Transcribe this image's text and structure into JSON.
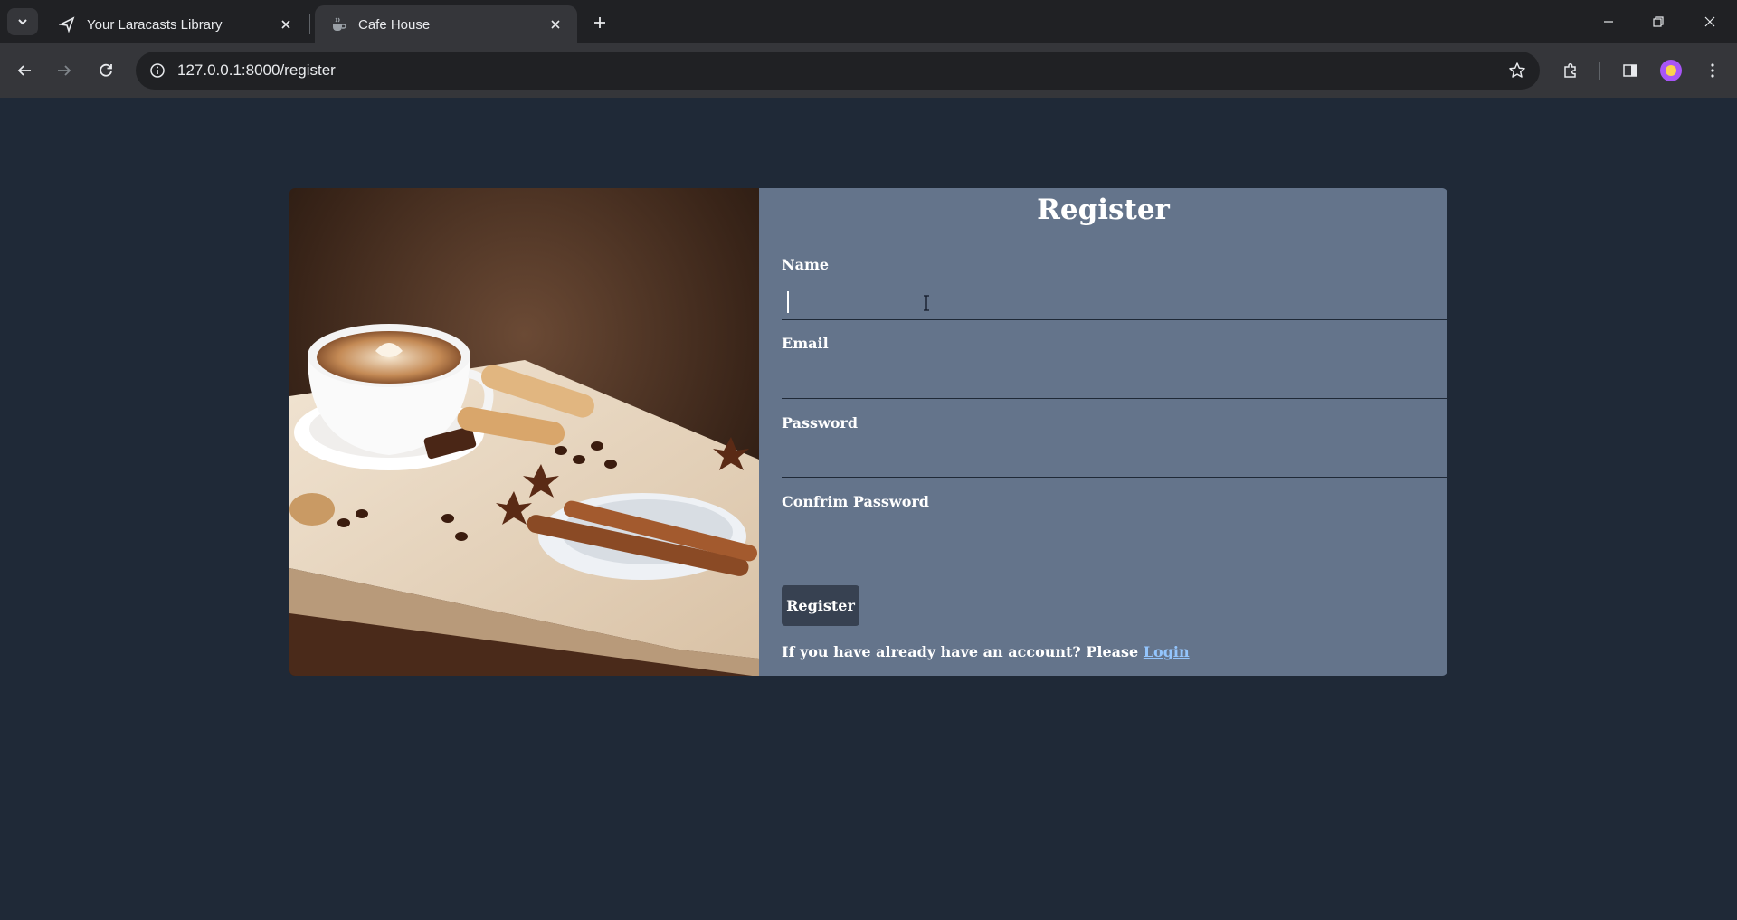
{
  "browser": {
    "tabs": [
      {
        "title": "Your Laracasts Library",
        "active": false
      },
      {
        "title": "Cafe House",
        "active": true
      }
    ],
    "url": "127.0.0.1:8000/register"
  },
  "page": {
    "title": "Register",
    "fields": [
      {
        "label": "Name",
        "value": ""
      },
      {
        "label": "Email",
        "value": ""
      },
      {
        "label": "Password",
        "value": ""
      },
      {
        "label": "Confrim Password",
        "value": ""
      }
    ],
    "submit_label": "Register",
    "footer_text": "If you have already have an account? Please",
    "login_label": "Login"
  },
  "colors": {
    "page_background": "#1f2937",
    "form_panel": "#64748b",
    "button": "#374151",
    "link": "#93c5fd"
  }
}
